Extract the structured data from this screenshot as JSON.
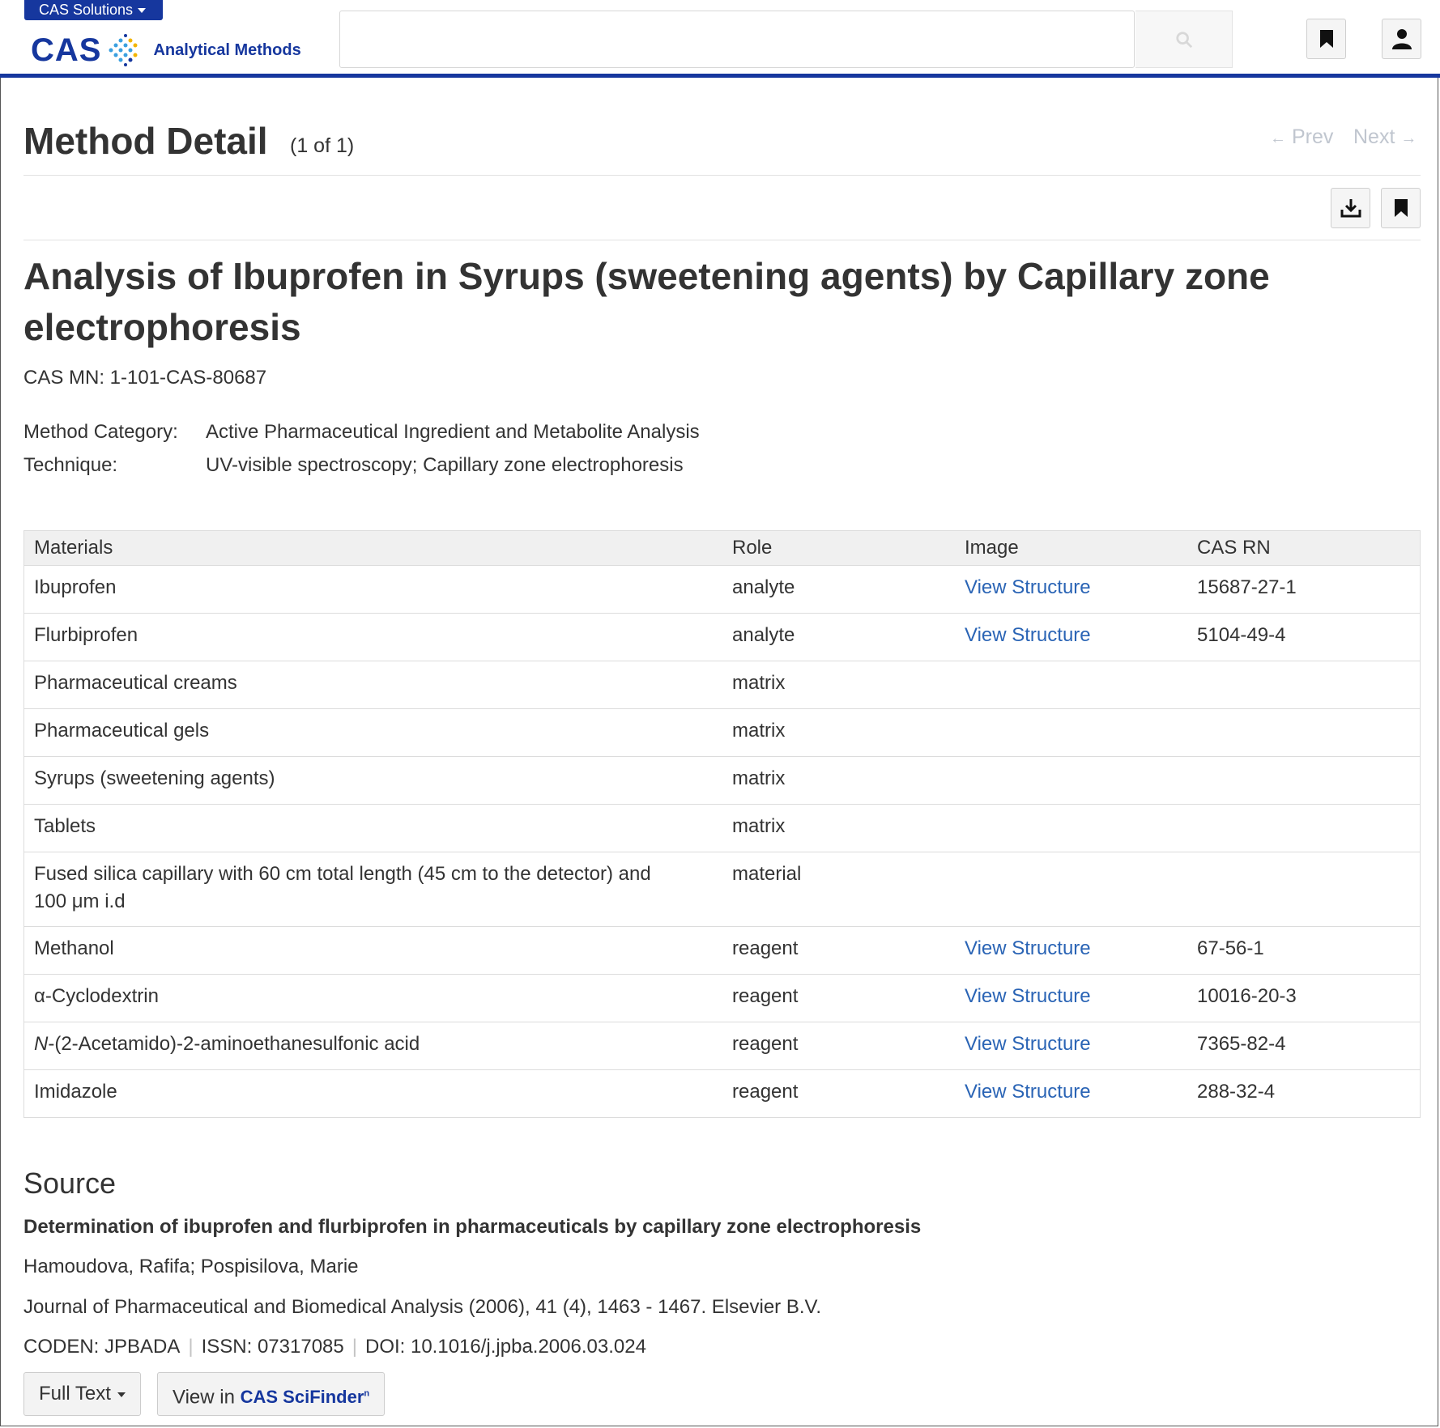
{
  "header": {
    "solutions_label": "CAS Solutions",
    "logo_text": "CAS",
    "product_name": "Analytical Methods",
    "search": {
      "value": "",
      "placeholder": ""
    }
  },
  "page": {
    "title": "Method Detail",
    "count": "(1 of 1)",
    "prev_label": "Prev",
    "next_label": "Next"
  },
  "method": {
    "title_line1": "Analysis of Ibuprofen in Syrups (sweetening agents) by Capillary zone",
    "title_line2": "electrophoresis",
    "cas_mn": "CAS MN: 1-101-CAS-80687",
    "category_label": "Method Category:",
    "category_value": "Active Pharmaceutical Ingredient and Metabolite Analysis",
    "technique_label": "Technique:",
    "technique_value": "UV-visible spectroscopy; Capillary zone electrophoresis"
  },
  "table": {
    "headers": [
      "Materials",
      "Role",
      "Image",
      "CAS RN"
    ],
    "rows": [
      {
        "material": "Ibuprofen",
        "role": "analyte",
        "image": "View Structure",
        "casrn": "15687-27-1"
      },
      {
        "material": "Flurbiprofen",
        "role": "analyte",
        "image": "View Structure",
        "casrn": "5104-49-4"
      },
      {
        "material": "Pharmaceutical creams",
        "role": "matrix",
        "image": "",
        "casrn": ""
      },
      {
        "material": "Pharmaceutical gels",
        "role": "matrix",
        "image": "",
        "casrn": ""
      },
      {
        "material": "Syrups (sweetening agents)",
        "role": "matrix",
        "image": "",
        "casrn": ""
      },
      {
        "material": "Tablets",
        "role": "matrix",
        "image": "",
        "casrn": ""
      },
      {
        "material": "Fused silica capillary with 60 cm total length (45 cm to the detector) and",
        "material_line2": "100 μm i.d",
        "role": "material",
        "image": "",
        "casrn": ""
      },
      {
        "material": "Methanol",
        "role": "reagent",
        "image": "View Structure",
        "casrn": "67-56-1"
      },
      {
        "material": "α-Cyclodextrin",
        "role": "reagent",
        "image": "View Structure",
        "casrn": "10016-20-3"
      },
      {
        "material_italic": "N",
        "material": "-(2-Acetamido)-2-aminoethanesulfonic acid",
        "role": "reagent",
        "image": "View Structure",
        "casrn": "7365-82-4"
      },
      {
        "material": "Imidazole",
        "role": "reagent",
        "image": "View Structure",
        "casrn": "288-32-4"
      }
    ]
  },
  "source": {
    "heading": "Source",
    "title": "Determination of ibuprofen and flurbiprofen in pharmaceuticals by capillary zone electrophoresis",
    "authors": "Hamoudova, Rafifa; Pospisilova, Marie",
    "journal": "Journal of Pharmaceutical and Biomedical Analysis (2006), 41 (4), 1463 - 1467. Elsevier B.V.",
    "coden": "CODEN: JPBADA",
    "issn": "ISSN: 07317085",
    "doi": "DOI: 10.1016/j.jpba.2006.03.024",
    "fulltext_label": "Full Text",
    "view_in_label": "View in",
    "scifinder_label": "CAS SciFinder",
    "scifinder_sup": "n"
  },
  "colors": {
    "brand": "#16379e",
    "link": "#2a64b5",
    "pager_disabled": "#c0c6cf"
  },
  "icons": [
    "search-icon",
    "bookmark-icon",
    "user-icon",
    "download-icon",
    "arrow-left-icon",
    "arrow-right-icon",
    "caret-down-icon"
  ]
}
